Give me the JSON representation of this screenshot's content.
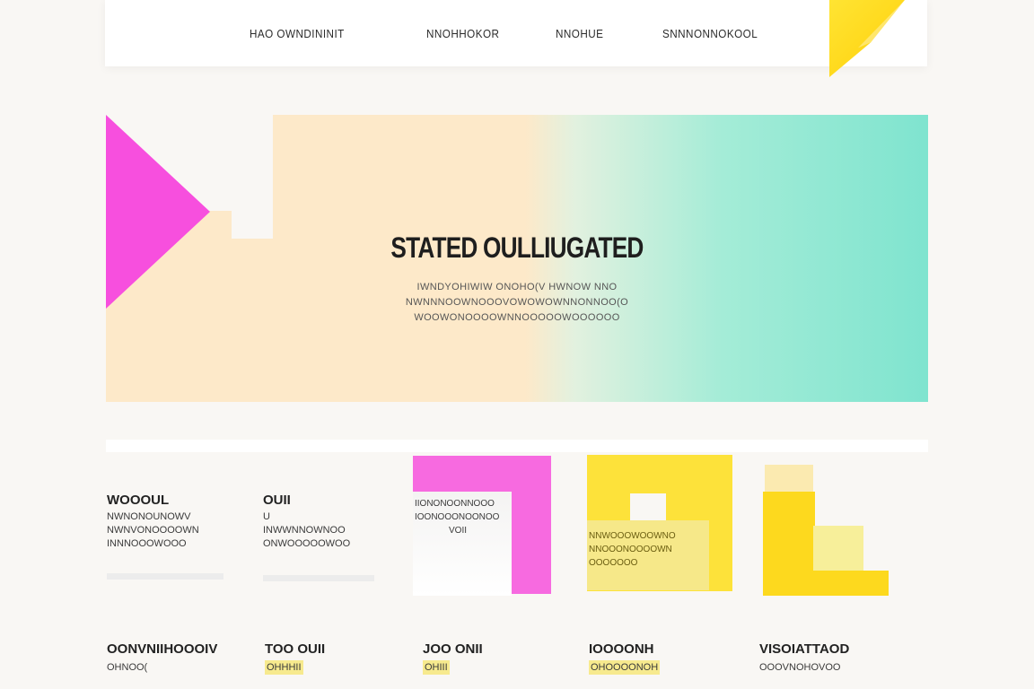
{
  "nav": {
    "links": [
      "HAO OWNDININIT",
      "NNOHHOKOR",
      "NNOHUE",
      "SNNNONNOKOOL"
    ]
  },
  "hero": {
    "title": "STATED OULLIUGATED",
    "subtitle_lines": [
      "IWNDYOHIWIW ONOHO(V HWNOW NNO",
      "NWNNNOOWNOOOVOWOWOWNNONNOO(O",
      "WOOWONOOOOWNNOOOOOWOOOOOO"
    ]
  },
  "cards_row1": [
    {
      "title": "WOOOUL",
      "lines": [
        "NWNONOUNOWV",
        "NWNVONOOOOWN",
        "INNNOOOWOOO"
      ]
    },
    {
      "title": "OUII",
      "lines": [
        "U",
        "INWWNNOWNOO",
        "ONWOOOOOWOO"
      ]
    }
  ],
  "tiles": {
    "pink_lines": [
      "IIONONOONNOOO",
      "IOONOOONOONOO",
      "VOII"
    ],
    "yellow_lines": [
      "NNWOOOWOOWNO",
      "NNOOONOOOOWN",
      "OOOOOOO"
    ]
  },
  "cards_row2": [
    {
      "title": "OONVNIIHOOOIV",
      "line": "OHNOO("
    },
    {
      "title": "TOO OUII",
      "line": "OHHHII"
    },
    {
      "title": "JOO ONII",
      "line": "OHIII"
    },
    {
      "title": "IOOOONH",
      "line": "OHOOOONOH"
    },
    {
      "title": "VISOIATTAOD",
      "line": "OOOVNOHOVOO"
    }
  ],
  "colors": {
    "accent_pink": "#f74fde",
    "accent_yellow": "#ffd81a",
    "hero_teal": "#7fe4cf",
    "hero_peach": "#fde9c9"
  }
}
